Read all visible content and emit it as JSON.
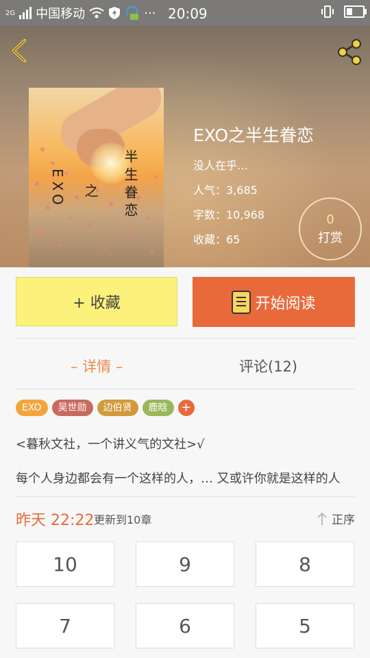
{
  "status": {
    "carrier": "中国移动",
    "time": "20:09",
    "net": "2G"
  },
  "book": {
    "title": "EXO之半生眷恋",
    "author": "没人在乎…",
    "popularity": "人气：3,685",
    "words": "字数：10,968",
    "favorites": "收藏：65",
    "cover_text": {
      "col1": "EXO",
      "col2": "之",
      "col3": "半生眷恋"
    }
  },
  "tip": {
    "count": "0",
    "label": "打赏"
  },
  "actions": {
    "favorite": "+ 收藏",
    "read": "开始阅读"
  },
  "tabs": {
    "detail": "– 详情 –",
    "comments": "评论(12)"
  },
  "tags": [
    {
      "label": "EXO",
      "color": "#f3a43b"
    },
    {
      "label": "吴世勋",
      "color": "#c86a5e"
    },
    {
      "label": "边伯贤",
      "color": "#d19a3a"
    },
    {
      "label": "鹿晗",
      "color": "#9ab85a"
    }
  ],
  "description": {
    "line1": "<暮秋文社，一个讲义气的文社>√",
    "line2": "每个人身边都会有一个这样的人，… 又或许你就是这样的人"
  },
  "update": {
    "time": "昨天 22:22",
    "text": "更新到10章",
    "sort": "正序"
  },
  "chapters": [
    "10",
    "9",
    "8",
    "7",
    "6",
    "5"
  ]
}
